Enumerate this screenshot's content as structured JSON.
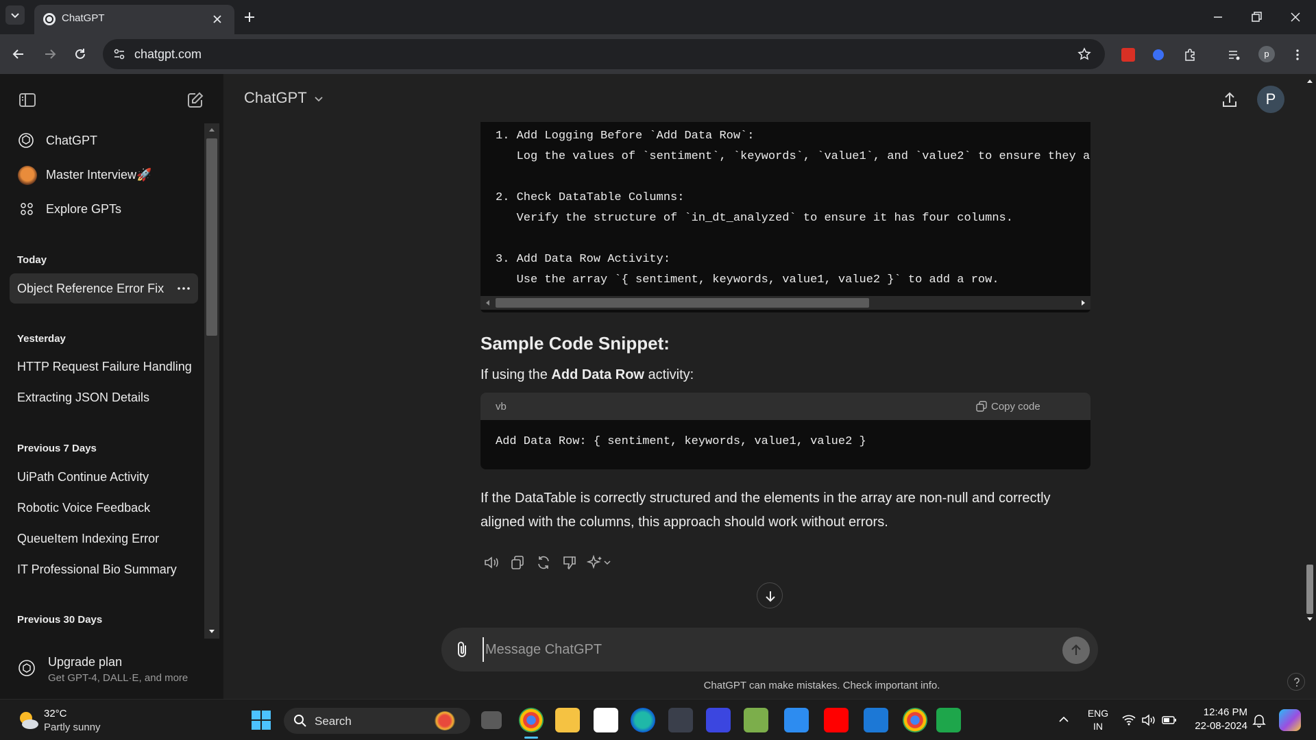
{
  "browser": {
    "tab_title": "ChatGPT",
    "url": "chatgpt.com",
    "profile_initial": "p"
  },
  "sidebar": {
    "pinned": [
      {
        "label": "ChatGPT",
        "icon": "openai-logo-icon"
      },
      {
        "label": "Master Interview🚀",
        "icon": "fox-avatar-icon"
      },
      {
        "label": "Explore GPTs",
        "icon": "grid-dots-icon"
      }
    ],
    "sections": {
      "today": {
        "heading": "Today",
        "items": [
          "Object Reference Error Fix"
        ]
      },
      "yesterday": {
        "heading": "Yesterday",
        "items": [
          "HTTP Request Failure Handling",
          "Extracting JSON Details"
        ]
      },
      "prev7": {
        "heading": "Previous 7 Days",
        "items": [
          "UiPath Continue Activity",
          "Robotic Voice Feedback",
          "QueueItem Indexing Error",
          "IT Professional Bio Summary"
        ]
      },
      "prev30": {
        "heading": "Previous 30 Days"
      }
    },
    "upgrade": {
      "title": "Upgrade plan",
      "subtitle": "Get GPT-4, DALL·E, and more"
    }
  },
  "main": {
    "model_name": "ChatGPT",
    "avatar_initial": "P",
    "code1_lines": [
      "1. Add Logging Before `Add Data Row`:",
      "   Log the values of `sentiment`, `keywords`, `value1`, and `value2` to ensure they are co",
      "",
      "2. Check DataTable Columns:",
      "   Verify the structure of `in_dt_analyzed` to ensure it has four columns.",
      "",
      "3. Add Data Row Activity:",
      "   Use the array `{ sentiment, keywords, value1, value2 }` to add a row."
    ],
    "heading": "Sample Code Snippet:",
    "intro_prefix": "If using the ",
    "intro_bold": "Add Data Row",
    "intro_suffix": " activity:",
    "code2": {
      "language": "vb",
      "copy_label": "Copy code",
      "code": "Add Data Row: { sentiment, keywords, value1, value2 }"
    },
    "paragraph": "If the DataTable is correctly structured and the elements in the array are non-null and correctly aligned with the columns, this approach should work without errors.",
    "composer_placeholder": "Message ChatGPT",
    "disclaimer": "ChatGPT can make mistakes. Check important info."
  },
  "taskbar": {
    "weather_temp": "32°C",
    "weather_desc": "Partly sunny",
    "search_label": "Search",
    "lang_top": "ENG",
    "lang_bottom": "IN",
    "time": "12:46 PM",
    "date": "22-08-2024"
  },
  "colors": {
    "background": "#212121",
    "sidebar": "#171717",
    "code_bg": "#0d0d0d",
    "composer": "#2f2f2f"
  }
}
